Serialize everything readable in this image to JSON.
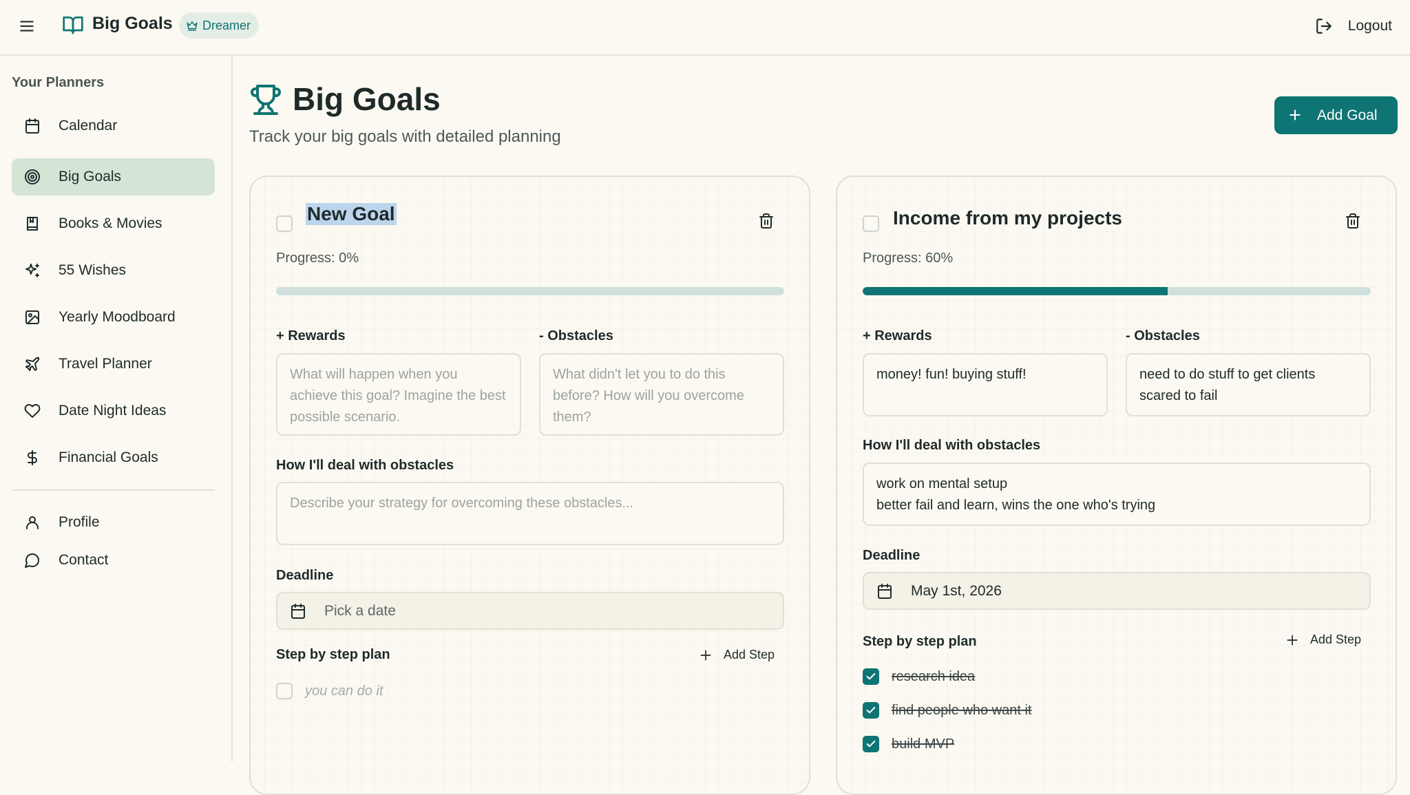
{
  "header": {
    "app_title": "Big Goals",
    "tier_badge": "Dreamer",
    "logout_label": "Logout"
  },
  "sidebar": {
    "heading": "Your Planners",
    "items": [
      {
        "label": "Calendar",
        "icon": "calendar-icon"
      },
      {
        "label": "Big Goals",
        "icon": "target-icon",
        "active": true
      },
      {
        "label": "Books & Movies",
        "icon": "book-icon"
      },
      {
        "label": "55 Wishes",
        "icon": "sparkles-icon"
      },
      {
        "label": "Yearly Moodboard",
        "icon": "image-icon"
      },
      {
        "label": "Travel Planner",
        "icon": "plane-icon"
      },
      {
        "label": "Date Night Ideas",
        "icon": "heart-icon"
      },
      {
        "label": "Financial Goals",
        "icon": "dollar-icon"
      }
    ],
    "secondary_items": [
      {
        "label": "Profile",
        "icon": "user-icon"
      },
      {
        "label": "Contact",
        "icon": "message-icon"
      }
    ]
  },
  "main": {
    "title": "Big Goals",
    "subtitle": "Track your big goals with detailed planning",
    "add_goal_label": "Add Goal"
  },
  "labels": {
    "rewards": "+ Rewards",
    "obstacles": "- Obstacles",
    "deal_with_obstacles": "How I'll deal with obstacles",
    "deadline": "Deadline",
    "step_plan": "Step by step plan",
    "add_step": "Add Step"
  },
  "goals": [
    {
      "title": "New Goal",
      "progress_label": "Progress: 0%",
      "progress": 0,
      "rewards_placeholder": "What will happen when you achieve this goal? Imagine the best possible scenario.",
      "rewards_value": "",
      "obstacles_placeholder": "What didn't let you to do this before? How will you overcome them?",
      "obstacles_value": "",
      "strategy_placeholder": "Describe your strategy for overcoming these obstacles...",
      "strategy_value": "",
      "deadline_placeholder": "Pick a date",
      "deadline_value": "",
      "steps": [
        {
          "text": "you can do it",
          "placeholder": true,
          "done": false
        }
      ]
    },
    {
      "title": "Income from my projects",
      "progress_label": "Progress: 60%",
      "progress": 0.6,
      "rewards_value": "money! fun! buying stuff!",
      "obstacles_value": "need to do stuff to get clients\nscared to fail",
      "strategy_value": "work on mental setup\nbetter fail and learn, wins the one who's trying",
      "deadline_value": "May 1st, 2026",
      "steps": [
        {
          "text": "research idea",
          "done": true
        },
        {
          "text": "find people who want it",
          "done": true
        },
        {
          "text": "build MVP",
          "done": true
        }
      ]
    }
  ],
  "colors": {
    "accent": "#0f7474",
    "background": "#fbf9f1",
    "active_nav": "#d6e4d6",
    "progress_track": "#cfe0dc",
    "title_highlight": "#bcd5ec"
  }
}
